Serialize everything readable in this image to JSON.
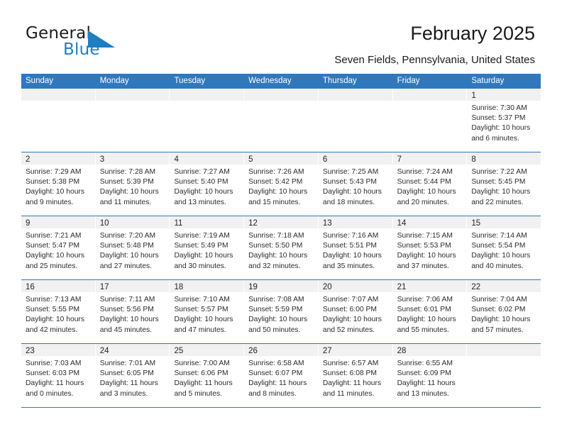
{
  "brand": {
    "name_part1": "General",
    "name_part2": "Blue",
    "triangle_color": "#1f7ec2"
  },
  "header": {
    "title": "February 2025",
    "location": "Seven Fields, Pennsylvania, United States"
  },
  "colors": {
    "header_blue": "#2f78bd",
    "daynum_band": "#f1f1f1",
    "text": "#2b2b2b"
  },
  "weekdays": [
    "Sunday",
    "Monday",
    "Tuesday",
    "Wednesday",
    "Thursday",
    "Friday",
    "Saturday"
  ],
  "labels": {
    "sunrise_prefix": "Sunrise:",
    "sunset_prefix": "Sunset:",
    "daylight_prefix": "Daylight:"
  },
  "weeks": [
    [
      {
        "empty": true
      },
      {
        "empty": true
      },
      {
        "empty": true
      },
      {
        "empty": true
      },
      {
        "empty": true
      },
      {
        "empty": true
      },
      {
        "day": "1",
        "sunrise": "Sunrise: 7:30 AM",
        "sunset": "Sunset: 5:37 PM",
        "daylight_line1": "Daylight: 10 hours",
        "daylight_line2": "and 6 minutes."
      }
    ],
    [
      {
        "day": "2",
        "sunrise": "Sunrise: 7:29 AM",
        "sunset": "Sunset: 5:38 PM",
        "daylight_line1": "Daylight: 10 hours",
        "daylight_line2": "and 9 minutes."
      },
      {
        "day": "3",
        "sunrise": "Sunrise: 7:28 AM",
        "sunset": "Sunset: 5:39 PM",
        "daylight_line1": "Daylight: 10 hours",
        "daylight_line2": "and 11 minutes."
      },
      {
        "day": "4",
        "sunrise": "Sunrise: 7:27 AM",
        "sunset": "Sunset: 5:40 PM",
        "daylight_line1": "Daylight: 10 hours",
        "daylight_line2": "and 13 minutes."
      },
      {
        "day": "5",
        "sunrise": "Sunrise: 7:26 AM",
        "sunset": "Sunset: 5:42 PM",
        "daylight_line1": "Daylight: 10 hours",
        "daylight_line2": "and 15 minutes."
      },
      {
        "day": "6",
        "sunrise": "Sunrise: 7:25 AM",
        "sunset": "Sunset: 5:43 PM",
        "daylight_line1": "Daylight: 10 hours",
        "daylight_line2": "and 18 minutes."
      },
      {
        "day": "7",
        "sunrise": "Sunrise: 7:24 AM",
        "sunset": "Sunset: 5:44 PM",
        "daylight_line1": "Daylight: 10 hours",
        "daylight_line2": "and 20 minutes."
      },
      {
        "day": "8",
        "sunrise": "Sunrise: 7:22 AM",
        "sunset": "Sunset: 5:45 PM",
        "daylight_line1": "Daylight: 10 hours",
        "daylight_line2": "and 22 minutes."
      }
    ],
    [
      {
        "day": "9",
        "sunrise": "Sunrise: 7:21 AM",
        "sunset": "Sunset: 5:47 PM",
        "daylight_line1": "Daylight: 10 hours",
        "daylight_line2": "and 25 minutes."
      },
      {
        "day": "10",
        "sunrise": "Sunrise: 7:20 AM",
        "sunset": "Sunset: 5:48 PM",
        "daylight_line1": "Daylight: 10 hours",
        "daylight_line2": "and 27 minutes."
      },
      {
        "day": "11",
        "sunrise": "Sunrise: 7:19 AM",
        "sunset": "Sunset: 5:49 PM",
        "daylight_line1": "Daylight: 10 hours",
        "daylight_line2": "and 30 minutes."
      },
      {
        "day": "12",
        "sunrise": "Sunrise: 7:18 AM",
        "sunset": "Sunset: 5:50 PM",
        "daylight_line1": "Daylight: 10 hours",
        "daylight_line2": "and 32 minutes."
      },
      {
        "day": "13",
        "sunrise": "Sunrise: 7:16 AM",
        "sunset": "Sunset: 5:51 PM",
        "daylight_line1": "Daylight: 10 hours",
        "daylight_line2": "and 35 minutes."
      },
      {
        "day": "14",
        "sunrise": "Sunrise: 7:15 AM",
        "sunset": "Sunset: 5:53 PM",
        "daylight_line1": "Daylight: 10 hours",
        "daylight_line2": "and 37 minutes."
      },
      {
        "day": "15",
        "sunrise": "Sunrise: 7:14 AM",
        "sunset": "Sunset: 5:54 PM",
        "daylight_line1": "Daylight: 10 hours",
        "daylight_line2": "and 40 minutes."
      }
    ],
    [
      {
        "day": "16",
        "sunrise": "Sunrise: 7:13 AM",
        "sunset": "Sunset: 5:55 PM",
        "daylight_line1": "Daylight: 10 hours",
        "daylight_line2": "and 42 minutes."
      },
      {
        "day": "17",
        "sunrise": "Sunrise: 7:11 AM",
        "sunset": "Sunset: 5:56 PM",
        "daylight_line1": "Daylight: 10 hours",
        "daylight_line2": "and 45 minutes."
      },
      {
        "day": "18",
        "sunrise": "Sunrise: 7:10 AM",
        "sunset": "Sunset: 5:57 PM",
        "daylight_line1": "Daylight: 10 hours",
        "daylight_line2": "and 47 minutes."
      },
      {
        "day": "19",
        "sunrise": "Sunrise: 7:08 AM",
        "sunset": "Sunset: 5:59 PM",
        "daylight_line1": "Daylight: 10 hours",
        "daylight_line2": "and 50 minutes."
      },
      {
        "day": "20",
        "sunrise": "Sunrise: 7:07 AM",
        "sunset": "Sunset: 6:00 PM",
        "daylight_line1": "Daylight: 10 hours",
        "daylight_line2": "and 52 minutes."
      },
      {
        "day": "21",
        "sunrise": "Sunrise: 7:06 AM",
        "sunset": "Sunset: 6:01 PM",
        "daylight_line1": "Daylight: 10 hours",
        "daylight_line2": "and 55 minutes."
      },
      {
        "day": "22",
        "sunrise": "Sunrise: 7:04 AM",
        "sunset": "Sunset: 6:02 PM",
        "daylight_line1": "Daylight: 10 hours",
        "daylight_line2": "and 57 minutes."
      }
    ],
    [
      {
        "day": "23",
        "sunrise": "Sunrise: 7:03 AM",
        "sunset": "Sunset: 6:03 PM",
        "daylight_line1": "Daylight: 11 hours",
        "daylight_line2": "and 0 minutes."
      },
      {
        "day": "24",
        "sunrise": "Sunrise: 7:01 AM",
        "sunset": "Sunset: 6:05 PM",
        "daylight_line1": "Daylight: 11 hours",
        "daylight_line2": "and 3 minutes."
      },
      {
        "day": "25",
        "sunrise": "Sunrise: 7:00 AM",
        "sunset": "Sunset: 6:06 PM",
        "daylight_line1": "Daylight: 11 hours",
        "daylight_line2": "and 5 minutes."
      },
      {
        "day": "26",
        "sunrise": "Sunrise: 6:58 AM",
        "sunset": "Sunset: 6:07 PM",
        "daylight_line1": "Daylight: 11 hours",
        "daylight_line2": "and 8 minutes."
      },
      {
        "day": "27",
        "sunrise": "Sunrise: 6:57 AM",
        "sunset": "Sunset: 6:08 PM",
        "daylight_line1": "Daylight: 11 hours",
        "daylight_line2": "and 11 minutes."
      },
      {
        "day": "28",
        "sunrise": "Sunrise: 6:55 AM",
        "sunset": "Sunset: 6:09 PM",
        "daylight_line1": "Daylight: 11 hours",
        "daylight_line2": "and 13 minutes."
      },
      {
        "empty": true
      }
    ]
  ]
}
